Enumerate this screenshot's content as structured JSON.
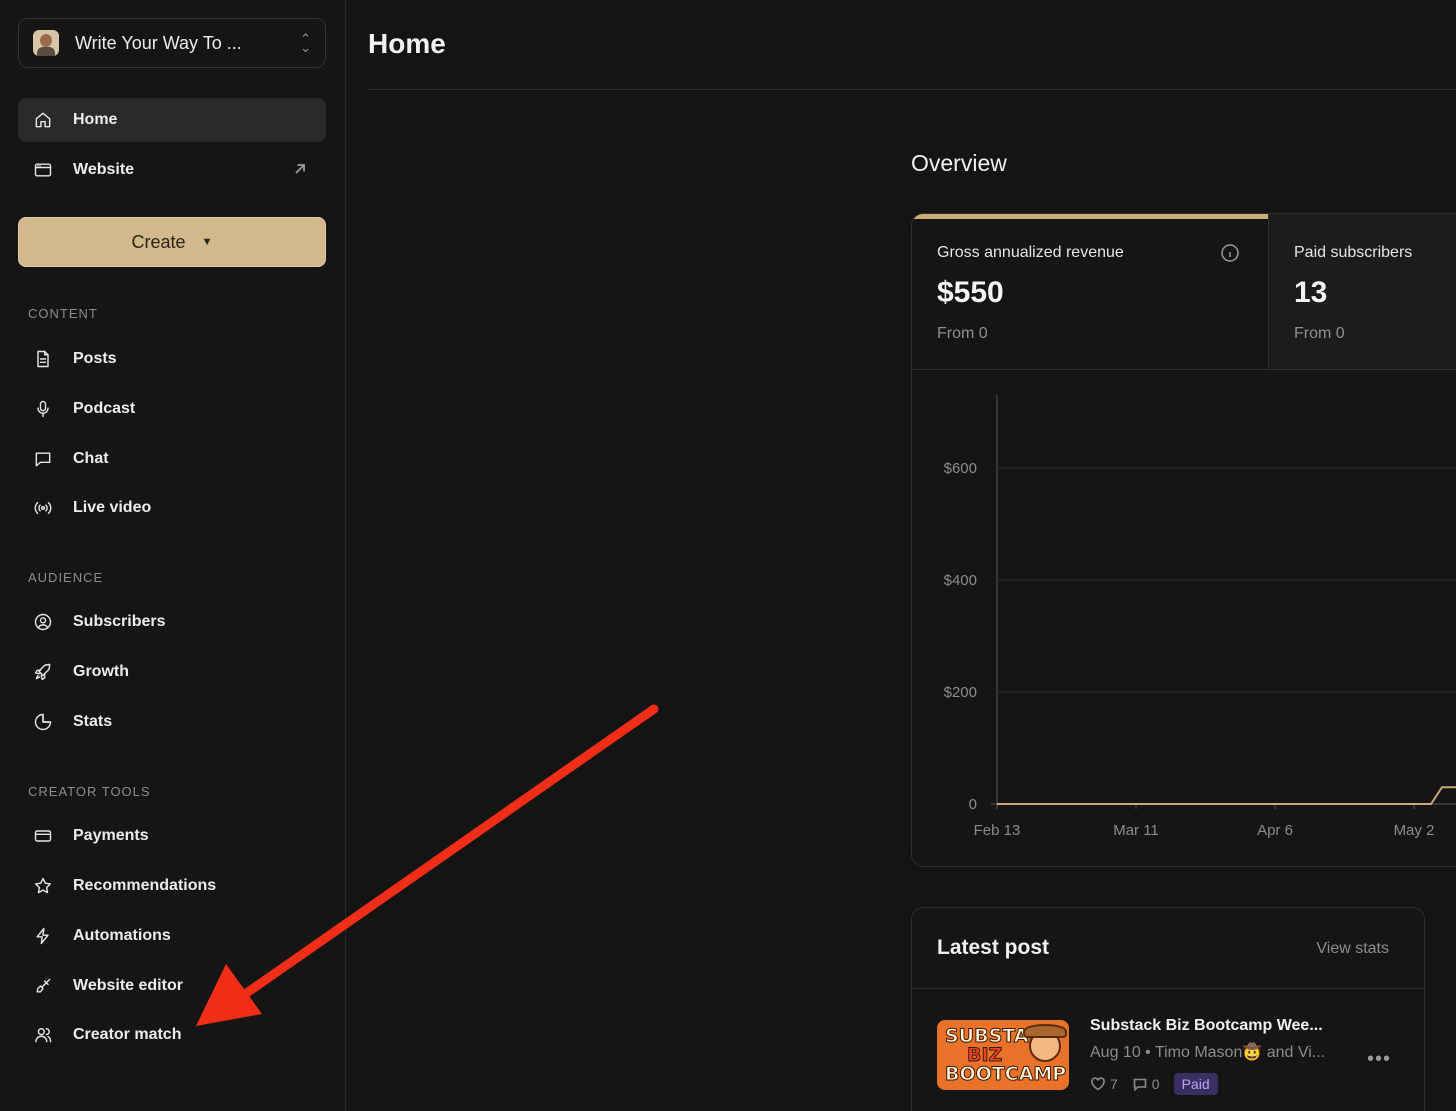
{
  "publication": {
    "name": "Write Your Way To ..."
  },
  "sidebar": {
    "top_items": [
      {
        "label": "Home",
        "icon": "home-icon",
        "active": true
      },
      {
        "label": "Website",
        "icon": "browser-window-icon"
      }
    ],
    "create_label": "Create",
    "sections": [
      {
        "heading": "CONTENT",
        "items": [
          {
            "label": "Posts",
            "icon": "document-icon"
          },
          {
            "label": "Podcast",
            "icon": "microphone-icon"
          },
          {
            "label": "Chat",
            "icon": "chat-bubble-icon"
          },
          {
            "label": "Live video",
            "icon": "broadcast-icon"
          }
        ]
      },
      {
        "heading": "AUDIENCE",
        "items": [
          {
            "label": "Subscribers",
            "icon": "user-circle-icon"
          },
          {
            "label": "Growth",
            "icon": "rocket-icon"
          },
          {
            "label": "Stats",
            "icon": "pie-chart-icon"
          }
        ]
      },
      {
        "heading": "CREATOR TOOLS",
        "items": [
          {
            "label": "Payments",
            "icon": "credit-card-icon"
          },
          {
            "label": "Recommendations",
            "icon": "star-icon"
          },
          {
            "label": "Automations",
            "icon": "lightning-icon"
          },
          {
            "label": "Website editor",
            "icon": "paintbrush-icon"
          },
          {
            "label": "Creator match",
            "icon": "users-icon"
          }
        ]
      }
    ]
  },
  "main": {
    "title": "Home",
    "overview_title": "Overview",
    "metrics": [
      {
        "label": "Gross annualized revenue",
        "value": "$550",
        "from": "From 0"
      },
      {
        "label": "Paid subscribers",
        "value": "13",
        "from": "From 0"
      }
    ],
    "latest": {
      "title": "Latest post",
      "view_stats": "View stats",
      "post_title": "Substack Biz Bootcamp Wee...",
      "post_meta": "Aug 10 • Timo Mason🤠 and Vi...",
      "likes": "7",
      "comments": "0",
      "badge": "Paid",
      "thumb_lines": [
        "SUBSTACK",
        "BIZ",
        "BOOTCAMP"
      ]
    }
  },
  "chart_data": {
    "type": "line",
    "x_ticks": [
      "Feb 13",
      "Mar 11",
      "Apr 6",
      "May 2"
    ],
    "y_ticks": [
      "$600",
      "$400",
      "$200",
      "0"
    ],
    "ylim": [
      0,
      730
    ],
    "grid": true,
    "series": [
      {
        "x": [
          "Feb 13",
          "Mar 11",
          "Apr 6",
          "Apr 28",
          "May 2",
          "May 5"
        ],
        "values": [
          0,
          0,
          0,
          0,
          0,
          30
        ]
      }
    ]
  },
  "colors": {
    "accent": "#d2b98c",
    "line": "#c9ab78",
    "arrow": "#f02d16"
  }
}
